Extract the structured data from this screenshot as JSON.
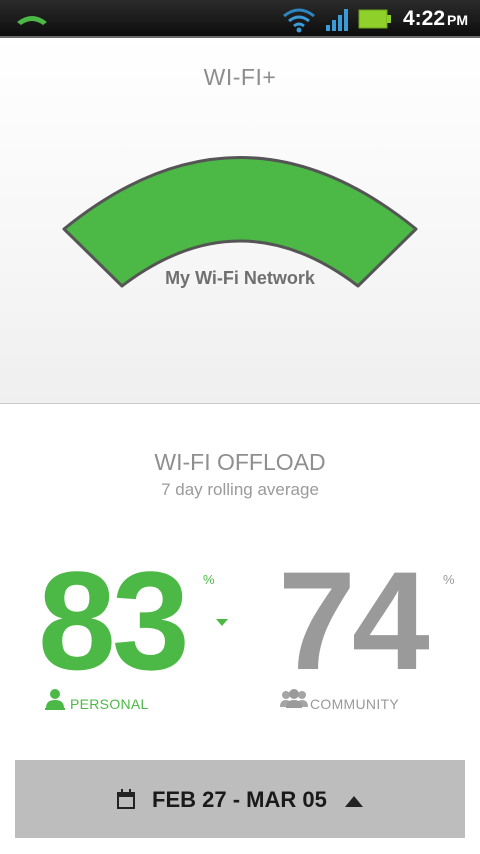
{
  "status_bar": {
    "time": "4:22",
    "ampm": "PM",
    "icons": [
      "phone-call-icon",
      "wifi-icon",
      "cell-signal-icon",
      "battery-icon"
    ]
  },
  "header": {
    "title": "WI-FI+"
  },
  "gauge": {
    "network_name": "My Wi-Fi Network",
    "color": "#4cb846"
  },
  "offload": {
    "title": "WI-FI OFFLOAD",
    "subtitle": "7 day rolling average",
    "personal": {
      "value": "83",
      "unit": "%",
      "label": "PERSONAL",
      "color": "#4cb846",
      "icon": "person-icon",
      "trend": "down"
    },
    "community": {
      "value": "74",
      "unit": "%",
      "label": "COMMUNITY",
      "color": "#9a9a9a",
      "icon": "group-icon"
    }
  },
  "date_range": {
    "label": "FEB 27 - MAR 05",
    "icon": "calendar-icon",
    "toggle_icon": "expand-up-icon"
  }
}
